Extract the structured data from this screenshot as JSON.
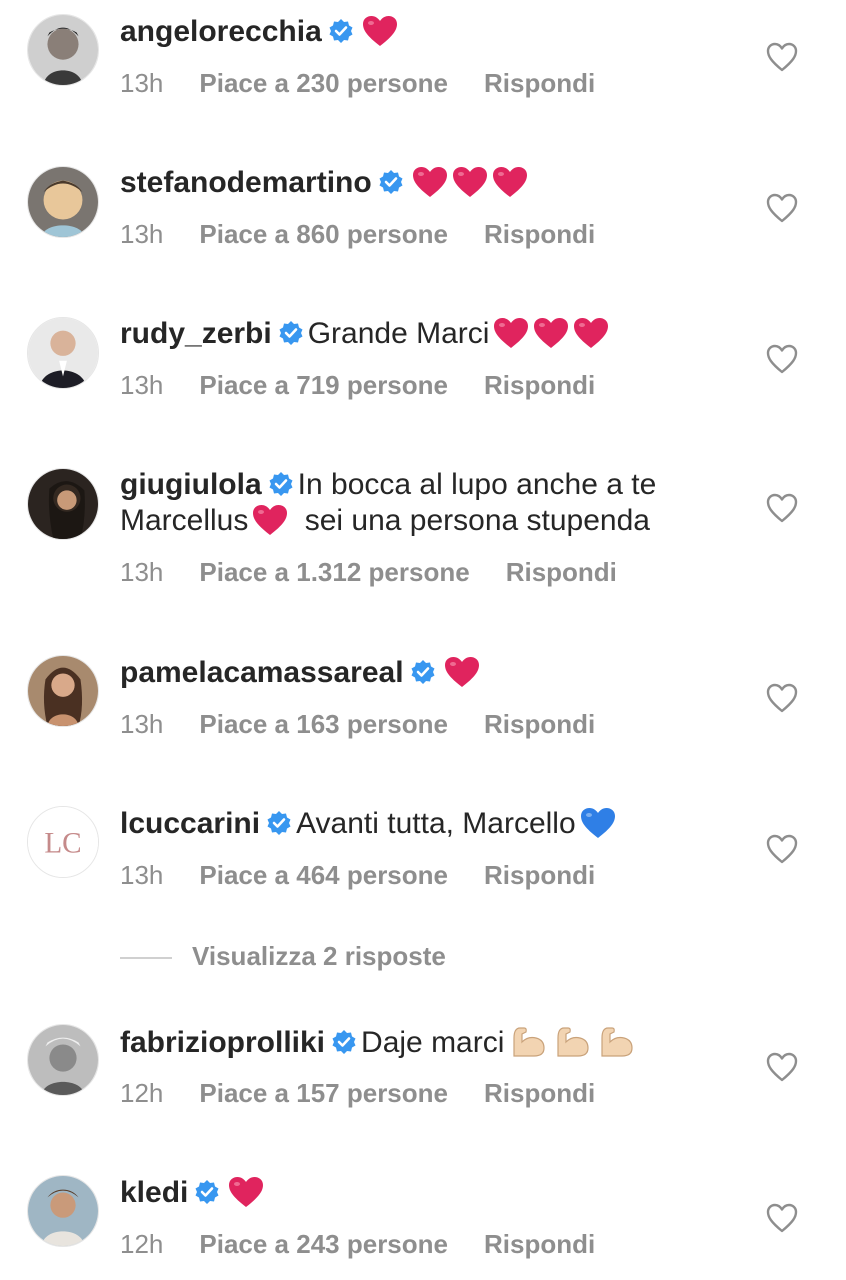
{
  "comments": [
    {
      "username": "angelorecchia",
      "text": "",
      "emoji": [
        "red-heart"
      ],
      "time": "13h",
      "likes": "Piace a 230 persone",
      "reply": "Rispondi"
    },
    {
      "username": "stefanodemartino",
      "text": "",
      "emoji": [
        "red-heart",
        "red-heart",
        "red-heart"
      ],
      "time": "13h",
      "likes": "Piace a 860 persone",
      "reply": "Rispondi"
    },
    {
      "username": "rudy_zerbi",
      "text": "Grande Marci",
      "emoji": [
        "red-heart",
        "red-heart",
        "red-heart"
      ],
      "time": "13h",
      "likes": "Piace a 719 persone",
      "reply": "Rispondi"
    },
    {
      "username": "giugiulola",
      "text_line1": "In bocca al lupo anche a te",
      "text_line2a": "Marcellus",
      "text_line2b": "sei una persona stupenda",
      "emoji": [
        "red-heart"
      ],
      "time": "13h",
      "likes": "Piace a 1.312 persone",
      "reply": "Rispondi"
    },
    {
      "username": "pamelacamassareal",
      "text": "",
      "emoji": [
        "red-heart"
      ],
      "time": "13h",
      "likes": "Piace a 163 persone",
      "reply": "Rispondi"
    },
    {
      "username": "lcuccarini",
      "text": "Avanti tutta, Marcello",
      "emoji": [
        "blue-heart"
      ],
      "time": "13h",
      "likes": "Piace a 464 persone",
      "reply": "Rispondi",
      "avatar_text": "LC"
    },
    {
      "username": "fabrizioprolliki",
      "text": "Daje marci",
      "emoji": [
        "flexed-biceps",
        "flexed-biceps",
        "flexed-biceps"
      ],
      "time": "12h",
      "likes": "Piace a 157 persone",
      "reply": "Rispondi"
    },
    {
      "username": "kledi",
      "text": "",
      "emoji": [
        "red-heart"
      ],
      "time": "12h",
      "likes": "Piace a 243 persone",
      "reply": "Rispondi"
    }
  ],
  "view_replies": "Visualizza 2 risposte",
  "colors": {
    "text": "#262626",
    "meta": "#8e8e8e",
    "verified": "#3897f0",
    "red_heart": "#e0245e",
    "blue_heart": "#2f7fe6",
    "biceps": "#f2d4b2"
  },
  "icons": {
    "verified": "verified-badge-icon",
    "like": "heart-outline-icon"
  }
}
